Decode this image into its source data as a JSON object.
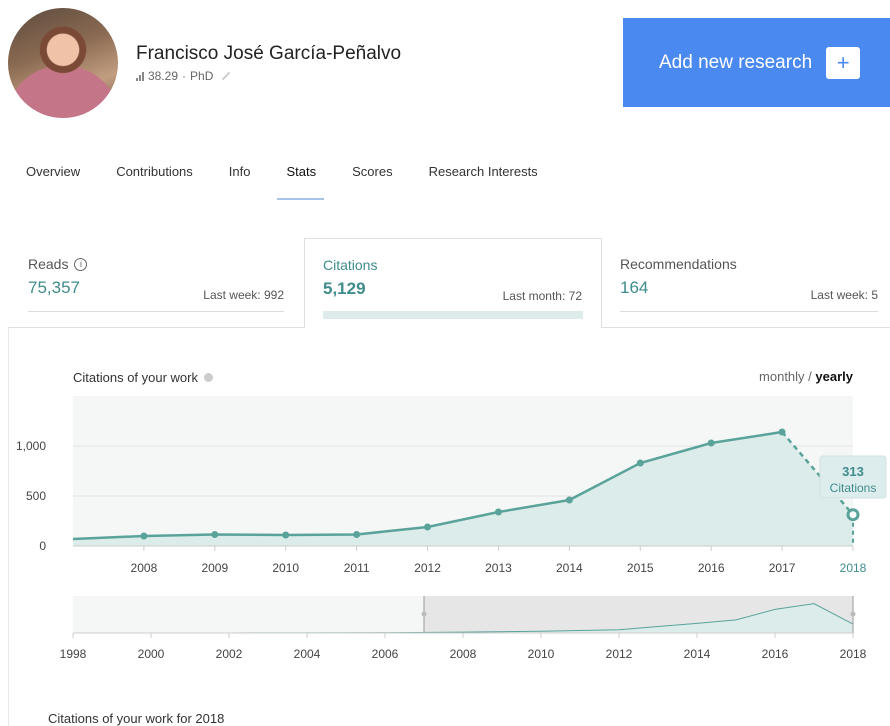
{
  "profile": {
    "name": "Francisco José García-Peñalvo",
    "score": "38.29",
    "separator": "·",
    "degree": "PhD"
  },
  "add_button": {
    "label": "Add new research",
    "plus": "+"
  },
  "tabs": [
    {
      "label": "Overview"
    },
    {
      "label": "Contributions"
    },
    {
      "label": "Info"
    },
    {
      "label": "Stats",
      "active": true
    },
    {
      "label": "Scores"
    },
    {
      "label": "Research Interests"
    }
  ],
  "stats": {
    "reads": {
      "label": "Reads",
      "value": "75,357",
      "sub": "Last week: 992"
    },
    "citations": {
      "label": "Citations",
      "value": "5,129",
      "sub": "Last month: 72"
    },
    "recommendations": {
      "label": "Recommendations",
      "value": "164",
      "sub": "Last week: 5"
    }
  },
  "chart_header": {
    "title": "Citations of your work",
    "toggle_monthly": "monthly",
    "toggle_sep": " / ",
    "toggle_yearly": "yearly"
  },
  "tooltip": {
    "value": "313",
    "label": "Citations"
  },
  "footer_title": "Citations of your work for 2018",
  "colors": {
    "accent": "#3f8c8c",
    "line": "#5aa39a",
    "area": "#dcecea",
    "button": "#4a89f0"
  },
  "chart_data": [
    {
      "type": "area",
      "x": [
        2007,
        2008,
        2009,
        2010,
        2011,
        2012,
        2013,
        2014,
        2015,
        2016,
        2017,
        2018
      ],
      "x_tick_labels": [
        "2008",
        "2009",
        "2010",
        "2011",
        "2012",
        "2013",
        "2014",
        "2015",
        "2016",
        "2017",
        "2018"
      ],
      "y_tick_labels": [
        "1,000",
        "500",
        "0"
      ],
      "series": [
        {
          "values": [
            70,
            100,
            115,
            110,
            115,
            190,
            340,
            460,
            830,
            1030,
            1140,
            313
          ]
        }
      ],
      "ylim": [
        0,
        1500
      ],
      "highlight": {
        "x": 2018,
        "y": 313
      }
    },
    {
      "type": "area",
      "x": [
        1998,
        2000,
        2002,
        2004,
        2006,
        2008,
        2010,
        2012,
        2014,
        2015,
        2016,
        2017,
        2018
      ],
      "x_tick_labels": [
        "1998",
        "2000",
        "2002",
        "2004",
        "2006",
        "2008",
        "2010",
        "2012",
        "2014",
        "2016",
        "2018"
      ],
      "series": [
        {
          "values": [
            0,
            0,
            2,
            5,
            10,
            30,
            60,
            115,
            340,
            460,
            830,
            1030,
            313
          ]
        }
      ],
      "selection_range": [
        2007,
        2018
      ]
    }
  ]
}
